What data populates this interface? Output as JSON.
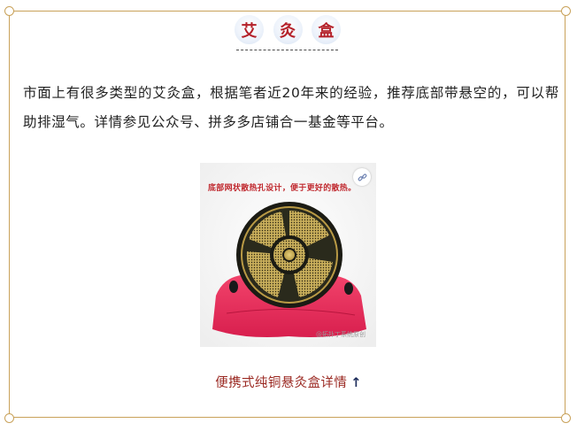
{
  "title": {
    "chars": [
      "艾",
      "灸",
      "盒"
    ]
  },
  "body": {
    "paragraph": "市面上有很多类型的艾灸盒，根据笔者近20年来的经验，推荐底部带悬空的，可以帮助排湿气。详情参见公众号、拼多多店铺合一基金等平台。"
  },
  "photo": {
    "caption": "底部网状散热孔设计，便于更好的散热。",
    "watermark": "@拓扑丁系统原创"
  },
  "link": {
    "text": "便携式纯铜悬灸盒详情",
    "arrow": "↑"
  },
  "colors": {
    "border": "#c9a25a",
    "title_text": "#b4212a",
    "link_text": "#9b2a23"
  },
  "icons": {
    "link_badge": "link-icon",
    "arrow": "arrow-up-icon"
  }
}
